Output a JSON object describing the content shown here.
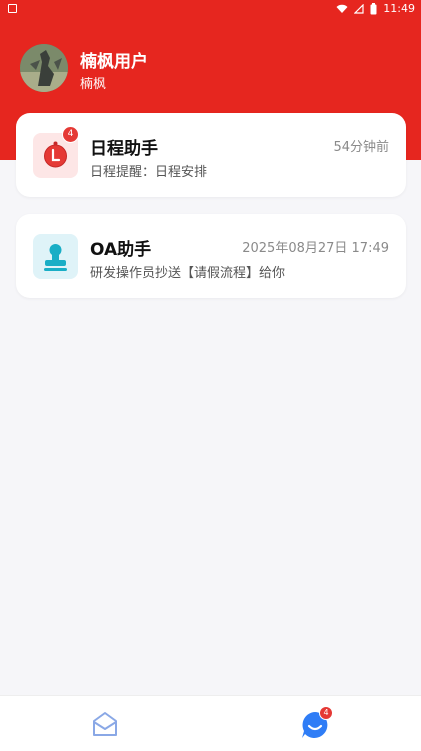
{
  "status_bar": {
    "time": "11:49"
  },
  "profile": {
    "name": "楠枫用户",
    "subtitle": "楠枫"
  },
  "messages": [
    {
      "title": "日程助手",
      "time": "54分钟前",
      "preview": "日程提醒：日程安排",
      "badge": "4",
      "icon": "clock-icon",
      "accent": "#e53935"
    },
    {
      "title": "OA助手",
      "time": "2025年08月27日 17:49",
      "preview": "研发操作员抄送【请假流程】给你",
      "icon": "stamp-icon",
      "accent": "#1ab0c8"
    }
  ],
  "bottom_nav": {
    "home_icon": "home-envelope-icon",
    "messages_icon": "chat-bubble-icon",
    "messages_badge": "4",
    "active_color": "#2f7df6"
  }
}
